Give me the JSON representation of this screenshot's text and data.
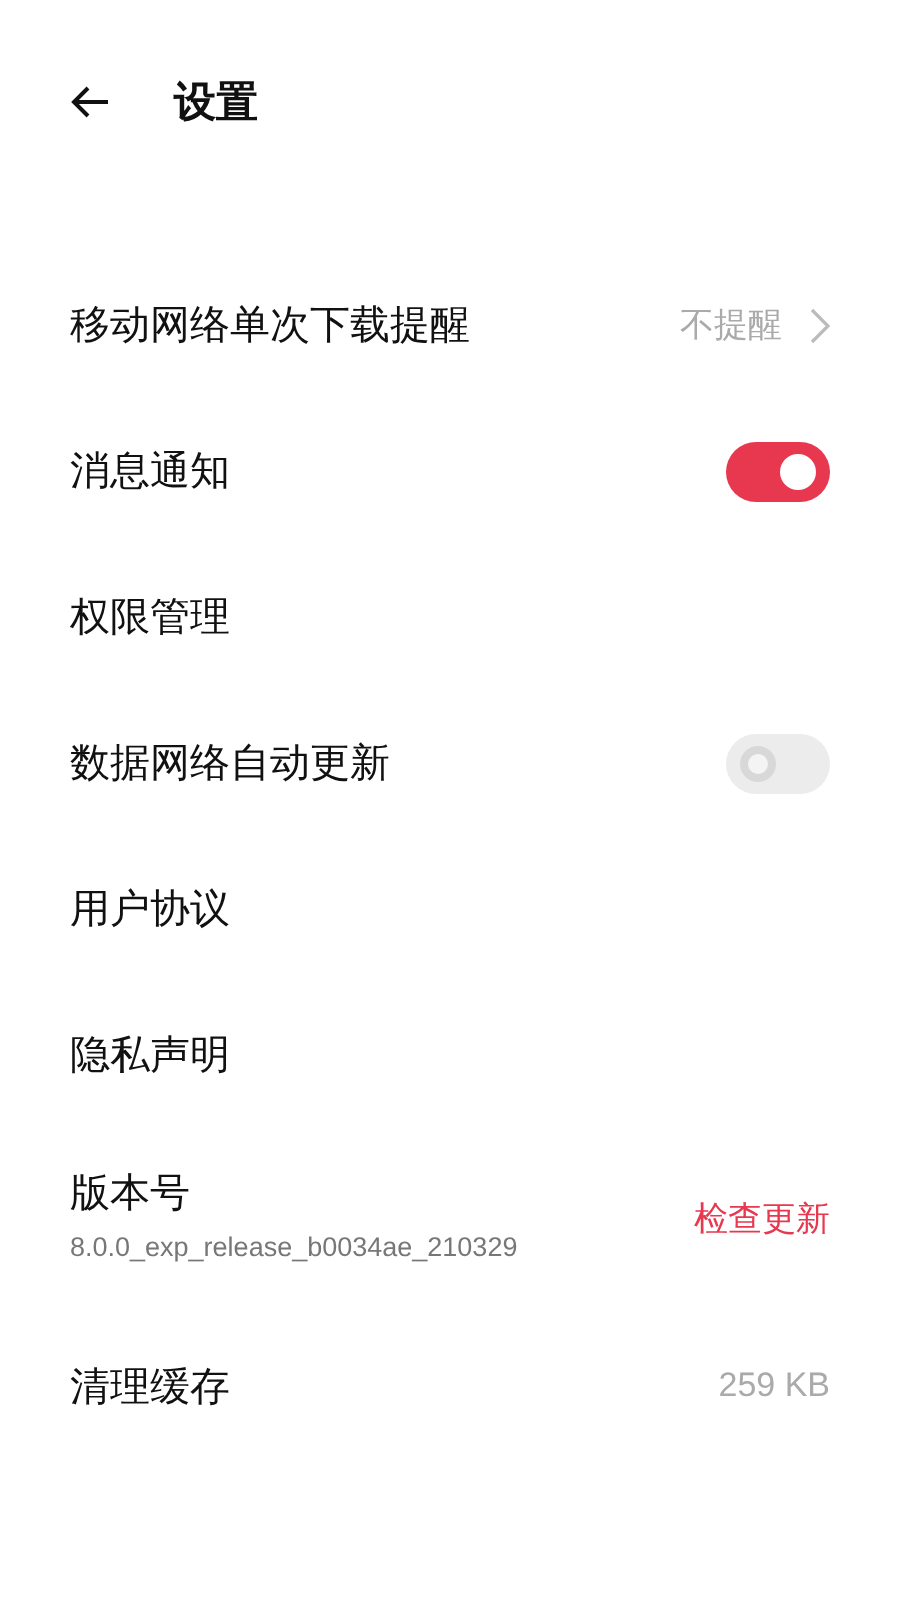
{
  "header": {
    "title": "设置"
  },
  "items": [
    {
      "kind": "value",
      "label": "移动网络单次下载提醒",
      "value": "不提醒"
    },
    {
      "kind": "toggle",
      "label": "消息通知",
      "on": true
    },
    {
      "kind": "plain",
      "label": "权限管理"
    },
    {
      "kind": "toggle",
      "label": "数据网络自动更新",
      "on": false
    },
    {
      "kind": "plain",
      "label": "用户协议"
    },
    {
      "kind": "plain",
      "label": "隐私声明"
    },
    {
      "kind": "version",
      "label": "版本号",
      "subtitle": "8.0.0_exp_release_b0034ae_210329",
      "action": "检查更新"
    },
    {
      "kind": "info",
      "label": "清理缓存",
      "value": "259 KB"
    }
  ]
}
